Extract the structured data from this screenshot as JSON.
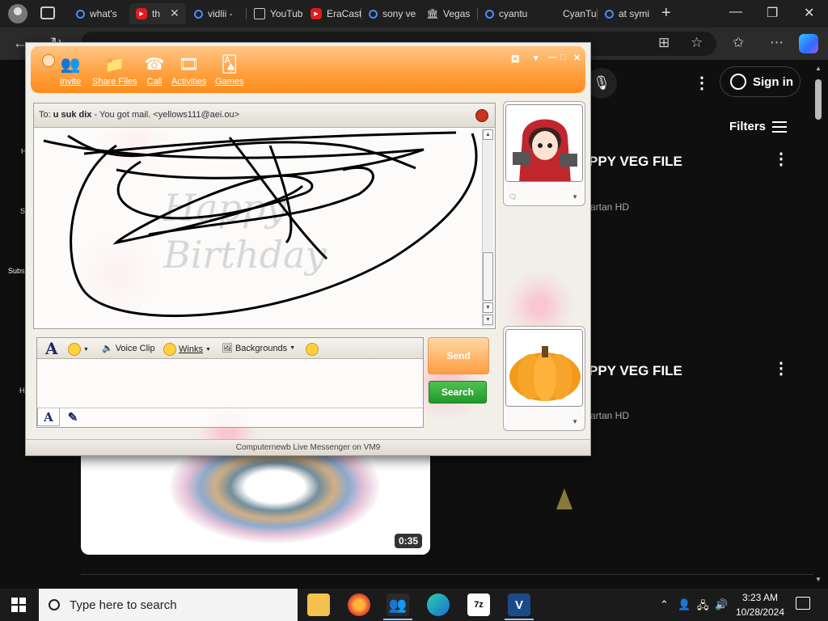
{
  "browser": {
    "tabs": [
      {
        "label": "what's",
        "icon": "search-icon"
      },
      {
        "label": "th",
        "icon": "youtube-icon",
        "active": true
      },
      {
        "label": "vidlii -",
        "icon": "search-icon"
      },
      {
        "label": "YouTub",
        "icon": "page-icon"
      },
      {
        "label": "EraCast",
        "icon": "youtube-icon"
      },
      {
        "label": "sony ve",
        "icon": "search-icon"
      },
      {
        "label": "Vegas",
        "icon": "bank-icon"
      },
      {
        "label": "cyantu",
        "icon": "search-icon"
      },
      {
        "label": "CyanTu",
        "icon": "blank-icon"
      },
      {
        "label": "at symi",
        "icon": "search-icon"
      }
    ],
    "tab_close_symbol": "✕",
    "new_tab_symbol": "+"
  },
  "youtube": {
    "signin_label": "Sign in",
    "filters_label": "Filters",
    "results": [
      {
        "title": "PPY VEG FILE",
        "channel": "artan HD"
      },
      {
        "title": "PPY VEG FILE",
        "channel": "artan HD"
      }
    ],
    "duration": "0:35",
    "side_labels": [
      "H",
      "S",
      "Subs",
      "H"
    ]
  },
  "messenger": {
    "toolbar": [
      {
        "label": "Invite",
        "icon": "invite-icon"
      },
      {
        "label": "Share Files",
        "icon": "folder-icon"
      },
      {
        "label": "Call",
        "icon": "phone-icon"
      },
      {
        "label": "Activities",
        "icon": "activities-icon"
      },
      {
        "label": "Games",
        "icon": "cards-icon"
      }
    ],
    "to_label": "To:",
    "contact_name": "u suk dix",
    "contact_status": "- You got mail.",
    "contact_email": "<yellows111@aei.ou>",
    "background_text_line1": "Happy",
    "background_text_line2": "Birthday",
    "compose_toolbar": {
      "font_label": "A",
      "voice_clip": "Voice Clip",
      "winks": "Winks",
      "backgrounds": "Backgrounds"
    },
    "send_label": "Send",
    "search_label": "Search",
    "status_text": "Computernewb Live Messenger on VM9"
  },
  "taskbar": {
    "search_placeholder": "Type here to search",
    "apps": [
      "file-explorer-icon",
      "firefox-icon",
      "messenger-icon",
      "edge-icon",
      "7zip-icon",
      "vegas-icon"
    ],
    "sevenzip_label": "7z",
    "vegas_label": "V",
    "time": "3:23 AM",
    "date": "10/28/2024"
  },
  "colors": {
    "messenger_orange": "#ff9f3d",
    "search_green": "#1f9a2a",
    "youtube_red": "#e21b1b"
  }
}
